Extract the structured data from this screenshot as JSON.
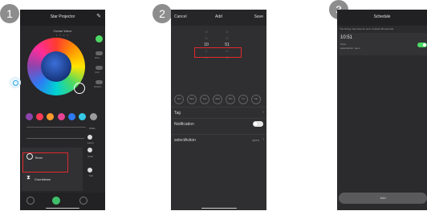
{
  "steps": [
    "1",
    "2",
    "3"
  ],
  "phone1": {
    "title": "Star Projector",
    "subtitle": "Ocean Wave",
    "dots": "• • • •",
    "side_labels": [
      "Wave",
      "Color",
      "Rotation"
    ],
    "slider_labels": [
      "White",
      "Lamp",
      "Color",
      "Fan"
    ],
    "menu": {
      "timer": "Timer",
      "countdown": "Countdown"
    },
    "swatch_colors": [
      "#8e44ad",
      "#ff3b57",
      "#ff9a2e",
      "#e84393",
      "#2d7bf4",
      "#35c9e6",
      "#9b9b9b"
    ]
  },
  "phone2": {
    "cancel": "Cancel",
    "title": "Add",
    "save": "Save",
    "hours": [
      "08",
      "09",
      "10",
      "11",
      "12"
    ],
    "minutes": [
      "49",
      "50",
      "51",
      "52",
      "53"
    ],
    "selected_hour": "10",
    "selected_minute": "51",
    "days": [
      "Sun",
      "Mon",
      "Tue",
      "Wed",
      "Thur",
      "Fri",
      "Sat"
    ],
    "tag_label": "Tag",
    "notification_label": "Notification",
    "action_label": "selectAction",
    "action_value": "open"
  },
  "phone3": {
    "title": "Schedule",
    "notice": "The timing may have an error of about 30 seconds.",
    "time": "10:51",
    "repeat": "Once",
    "action": "selectAction: open",
    "toggle_on": true,
    "add_button": "Add"
  },
  "colors": {
    "highlight": "#e0292f",
    "toggle_on": "#4cd964",
    "panel": "#272729"
  }
}
